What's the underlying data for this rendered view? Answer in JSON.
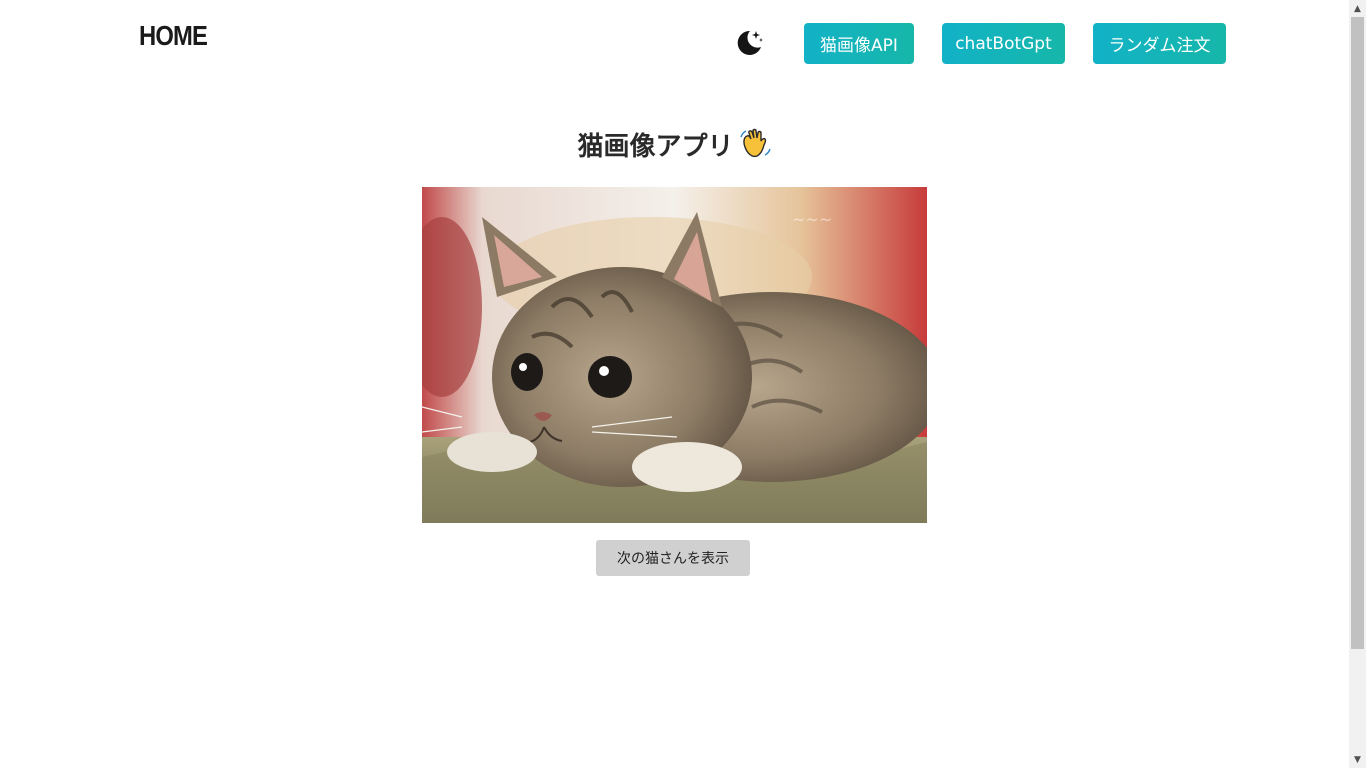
{
  "header": {
    "logo": "HOME",
    "theme_toggle_icon": "moon-stars-icon",
    "nav": [
      {
        "label": "猫画像API"
      },
      {
        "label": "chatBotGpt"
      },
      {
        "label": "ランダム注文"
      }
    ],
    "accent_gradient": [
      "#12b2c7",
      "#16b7a9"
    ]
  },
  "main": {
    "title": "猫画像アプリ",
    "title_emoji_icon": "waving-hand-icon",
    "image_subject": "kitten photo",
    "next_button": "次の猫さんを表示"
  },
  "scrollbar": {
    "up_icon": "arrow-up-icon",
    "down_icon": "arrow-down-icon"
  }
}
